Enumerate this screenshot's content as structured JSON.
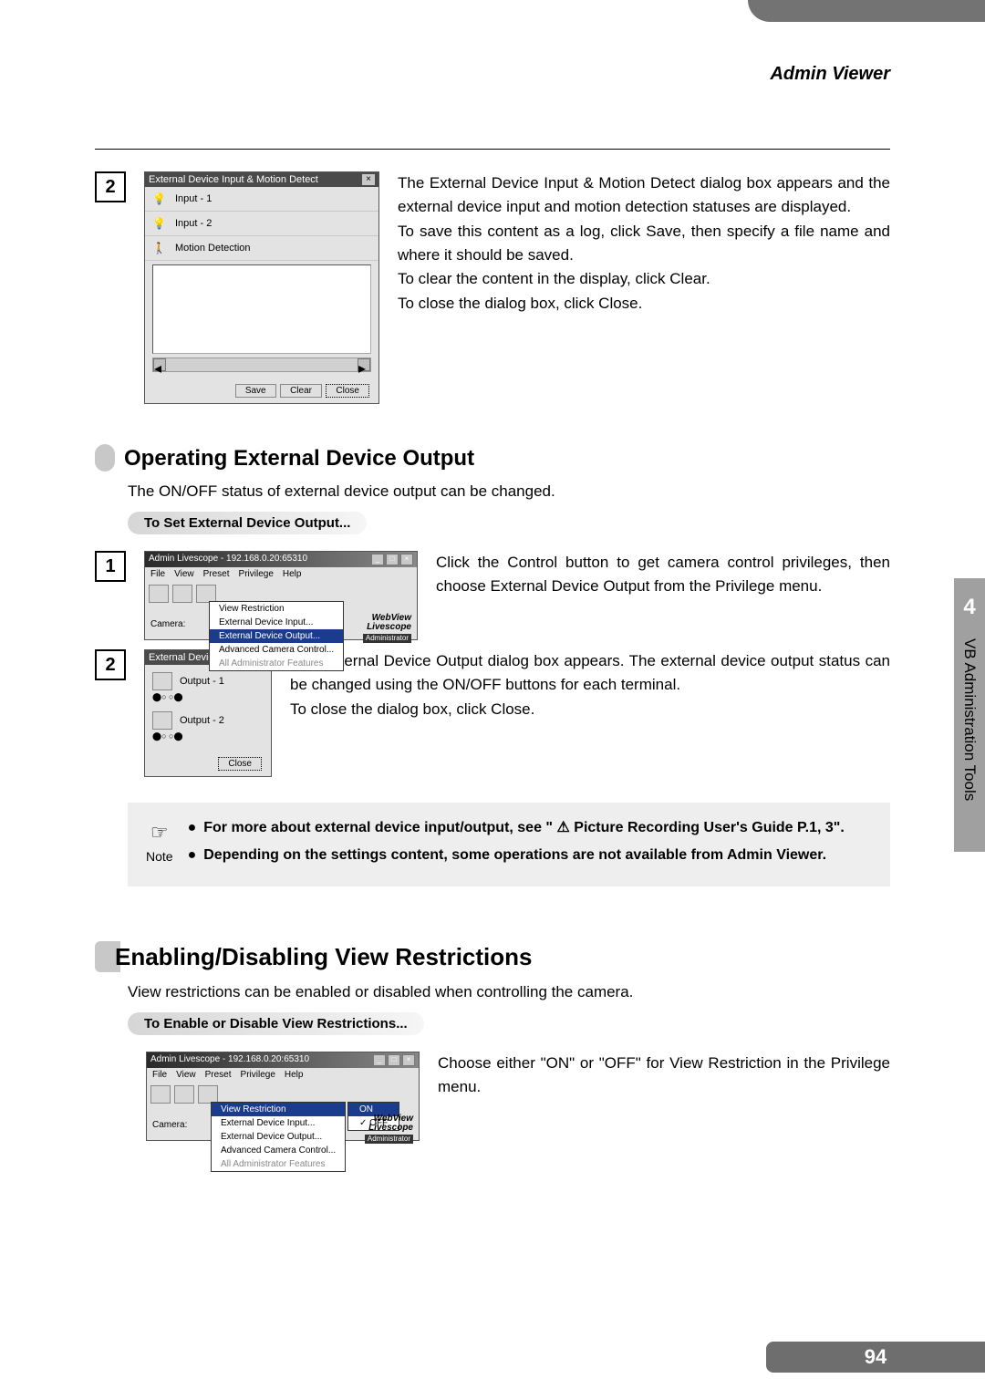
{
  "header": {
    "title": "Admin Viewer"
  },
  "side_tab": {
    "number": "4",
    "label": "VB Administration Tools"
  },
  "page_number": "94",
  "step2top": {
    "dialog_title": "External Device Input & Motion Detect",
    "inputs": [
      "Input - 1",
      "Input - 2",
      "Motion Detection"
    ],
    "buttons": {
      "save": "Save",
      "clear": "Clear",
      "close": "Close"
    },
    "prose1": "The External Device Input & Motion Detect dialog box appears and the external device input and motion detection statuses are displayed.",
    "prose2": "To save this content as a log, click Save, then specify a file name and where it should be saved.",
    "prose3": "To clear the content in the display, click Clear.",
    "prose4": "To close the dialog box, click Close."
  },
  "section_output": {
    "heading": "Operating External Device Output",
    "intro": "The ON/OFF status of external device output can be changed.",
    "sub": "To Set External Device Output..."
  },
  "livescope": {
    "title": "Admin Livescope - 192.168.0.20:65310",
    "menus": [
      "File",
      "View",
      "Preset",
      "Privilege",
      "Help"
    ],
    "sub_items": [
      "View Restriction",
      "External Device Input...",
      "External Device Output...",
      "Advanced Camera Control...",
      "All Administrator Features"
    ],
    "camera_label": "Camera:",
    "wv": "WebView Livescope",
    "admin_badge": "Administrator"
  },
  "onoff": {
    "on": "ON",
    "off": "OFF"
  },
  "step1_prose": "Click the Control button to get camera control privileges, then choose External Device Output from the Privilege menu.",
  "output_dialog": {
    "title": "External Device Output",
    "outputs": [
      "Output - 1",
      "Output - 2"
    ],
    "close": "Close"
  },
  "step2b_prose1": "The External Device Output dialog box appears. The external device output status can be changed using the ON/OFF buttons for each terminal.",
  "step2b_prose2": "To close the dialog box, click Close.",
  "note": {
    "label": "Note",
    "b1a": "For more about external device input/output, see \"",
    "b1b": "Picture Recording User's Guide P.1, 3\".",
    "b2": "Depending on the settings content, some operations are not available from Admin Viewer."
  },
  "section_view": {
    "heading": "Enabling/Disabling View Restrictions",
    "intro": "View restrictions can be enabled or disabled when controlling the camera.",
    "sub": "To Enable or Disable View Restrictions...",
    "prose": "Choose either \"ON\" or \"OFF\" for View Restriction in the Privilege menu."
  }
}
